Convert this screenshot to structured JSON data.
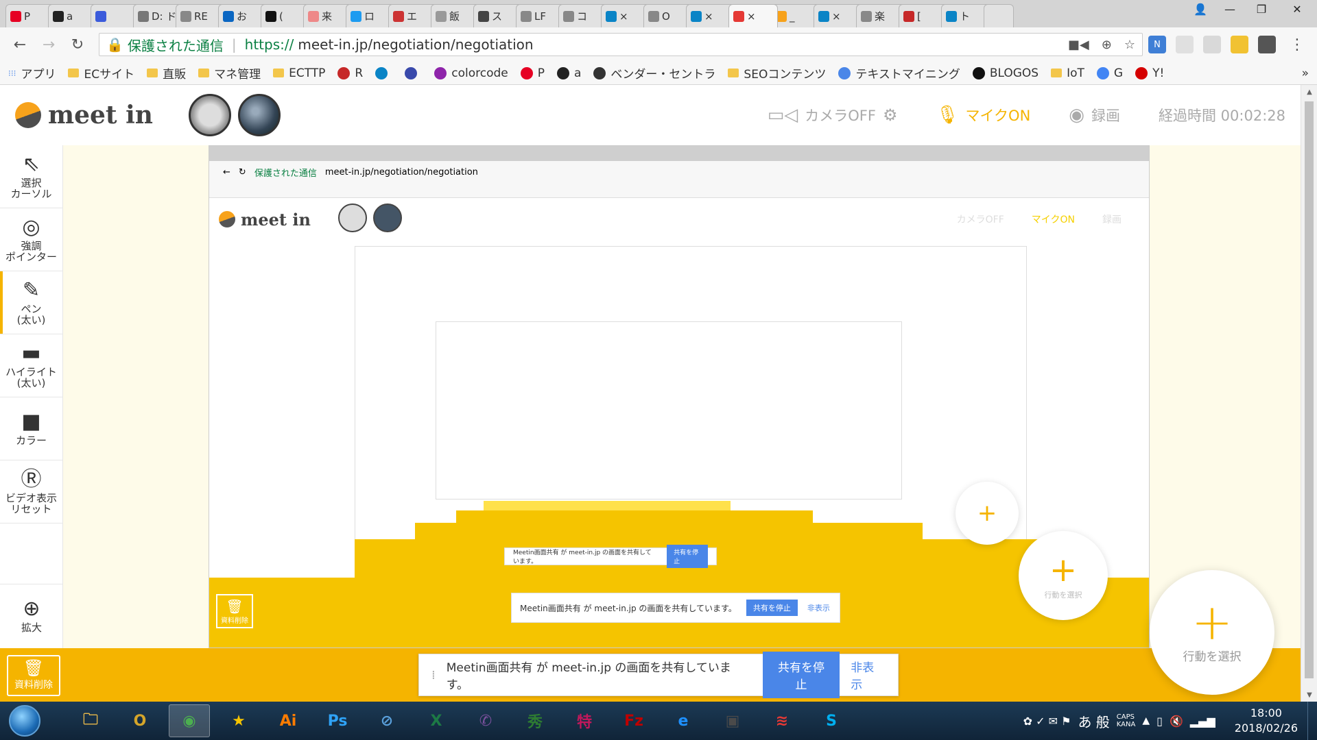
{
  "browser": {
    "tabs": [
      {
        "label": "P",
        "color": "#e60023"
      },
      {
        "label": "a",
        "color": "#222"
      },
      {
        "label": "",
        "color": "#3b5bdb"
      },
      {
        "label": "D: ド",
        "color": "#777"
      },
      {
        "label": "RE",
        "color": "#888"
      },
      {
        "label": "お",
        "color": "#0a66c2"
      },
      {
        "label": "(",
        "color": "#111"
      },
      {
        "label": "来",
        "color": "#e88"
      },
      {
        "label": "ロ",
        "color": "#1d9bf0"
      },
      {
        "label": "エ",
        "color": "#c33"
      },
      {
        "label": "飯",
        "color": "#999"
      },
      {
        "label": "ス",
        "color": "#444"
      },
      {
        "label": "LF",
        "color": "#888"
      },
      {
        "label": "コ",
        "color": "#888"
      },
      {
        "label": "×",
        "color": "#0a84c6"
      },
      {
        "label": "O",
        "color": "#888"
      },
      {
        "label": "×",
        "color": "#0a84c6"
      },
      {
        "label": "×",
        "color": "#e53935"
      },
      {
        "label": "_",
        "color": "#f7a21b"
      },
      {
        "label": "×",
        "color": "#0a84c6"
      },
      {
        "label": "楽",
        "color": "#888"
      },
      {
        "label": "[",
        "color": "#c62828"
      },
      {
        "label": "ト",
        "color": "#0a84c6"
      }
    ],
    "active_tab_index": 17,
    "secure_label": "保護された通信",
    "url_proto": "https://",
    "url_rest": "meet-in.jp/negotiation/negotiation",
    "window_controls": [
      "—",
      "❐",
      "✕"
    ]
  },
  "bookmarks": [
    {
      "label": "アプリ",
      "type": "apps"
    },
    {
      "label": "ECサイト",
      "type": "folder"
    },
    {
      "label": "直販",
      "type": "folder"
    },
    {
      "label": "マネ管理",
      "type": "folder"
    },
    {
      "label": "ECTTP",
      "type": "folder"
    },
    {
      "label": "R",
      "type": "icon",
      "color": "#c62828"
    },
    {
      "label": "",
      "type": "icon",
      "color": "#0a84c6"
    },
    {
      "label": "",
      "type": "icon",
      "color": "#3949ab"
    },
    {
      "label": "colorcode",
      "type": "icon",
      "color": "#8e24aa"
    },
    {
      "label": "P",
      "type": "icon",
      "color": "#e60023"
    },
    {
      "label": "a",
      "type": "icon",
      "color": "#222"
    },
    {
      "label": "ベンダー・セントラ",
      "type": "icon",
      "color": "#333"
    },
    {
      "label": "SEOコンテンツ",
      "type": "folder"
    },
    {
      "label": "テキストマイニング",
      "type": "icon",
      "color": "#4a86e8"
    },
    {
      "label": "BLOGOS",
      "type": "icon",
      "color": "#111"
    },
    {
      "label": "IoT",
      "type": "folder"
    },
    {
      "label": "G",
      "type": "icon",
      "color": "#4285f4"
    },
    {
      "label": "Y!",
      "type": "icon",
      "color": "#d50000"
    }
  ],
  "app": {
    "logo_text": "meet in",
    "camera_label": "カメラOFF",
    "mic_label": "マイクON",
    "record_label": "録画",
    "elapsed_label": "経過時間",
    "elapsed_time": "00:02:28"
  },
  "tools": [
    {
      "name": "select-cursor",
      "icon": "⇖",
      "label": "選択\nカーソル"
    },
    {
      "name": "emphasis-pointer",
      "icon": "◎",
      "label": "強調\nポインター"
    },
    {
      "name": "pen-thick",
      "icon": "✎",
      "label": "ペン\n(太い)"
    },
    {
      "name": "highlight-thick",
      "icon": "▬",
      "label": "ハイライト\n(太い)"
    },
    {
      "name": "color",
      "icon": "■",
      "label": "カラー"
    },
    {
      "name": "video-reset",
      "icon": "Ⓡ",
      "label": "ビデオ表示\nリセット"
    }
  ],
  "zoom_tool": {
    "icon": "⊕",
    "label": "拡大"
  },
  "trash": {
    "label": "資料削除"
  },
  "share_notice": {
    "text": "Meetin画面共有 が meet-in.jp の画面を共有しています。",
    "stop_label": "共有を停止",
    "hide_label": "非表示"
  },
  "fab": {
    "plus": "+",
    "label": "行動を選択"
  },
  "taskbar": {
    "apps": [
      {
        "name": "explorer",
        "label": "🗀",
        "color": "#e8b84a"
      },
      {
        "name": "outlook",
        "label": "O",
        "color": "#d4a52a"
      },
      {
        "name": "chrome",
        "label": "◉",
        "color": "#4caf50"
      },
      {
        "name": "favorites",
        "label": "★",
        "color": "#f5c400"
      },
      {
        "name": "illustrator",
        "label": "Ai",
        "color": "#ff7c00"
      },
      {
        "name": "photoshop",
        "label": "Ps",
        "color": "#2fa3f7"
      },
      {
        "name": "safari",
        "label": "⊘",
        "color": "#5aa0dc"
      },
      {
        "name": "excel",
        "label": "X",
        "color": "#1d7a45"
      },
      {
        "name": "viber",
        "label": "✆",
        "color": "#7b519d"
      },
      {
        "name": "app-hide",
        "label": "秀",
        "color": "#2e7d32"
      },
      {
        "name": "app-toku",
        "label": "特",
        "color": "#c2185b"
      },
      {
        "name": "filezilla",
        "label": "Fz",
        "color": "#bf0000"
      },
      {
        "name": "ie",
        "label": "e",
        "color": "#1e90ff"
      },
      {
        "name": "monitor",
        "label": "▣",
        "color": "#4a4a4a"
      },
      {
        "name": "stack",
        "label": "≋",
        "color": "#e53935"
      },
      {
        "name": "skype",
        "label": "S",
        "color": "#00aff0"
      }
    ],
    "ime": "あ 般",
    "caps": "CAPS",
    "kana": "KANA",
    "time": "18:00",
    "date": "2018/02/26"
  }
}
